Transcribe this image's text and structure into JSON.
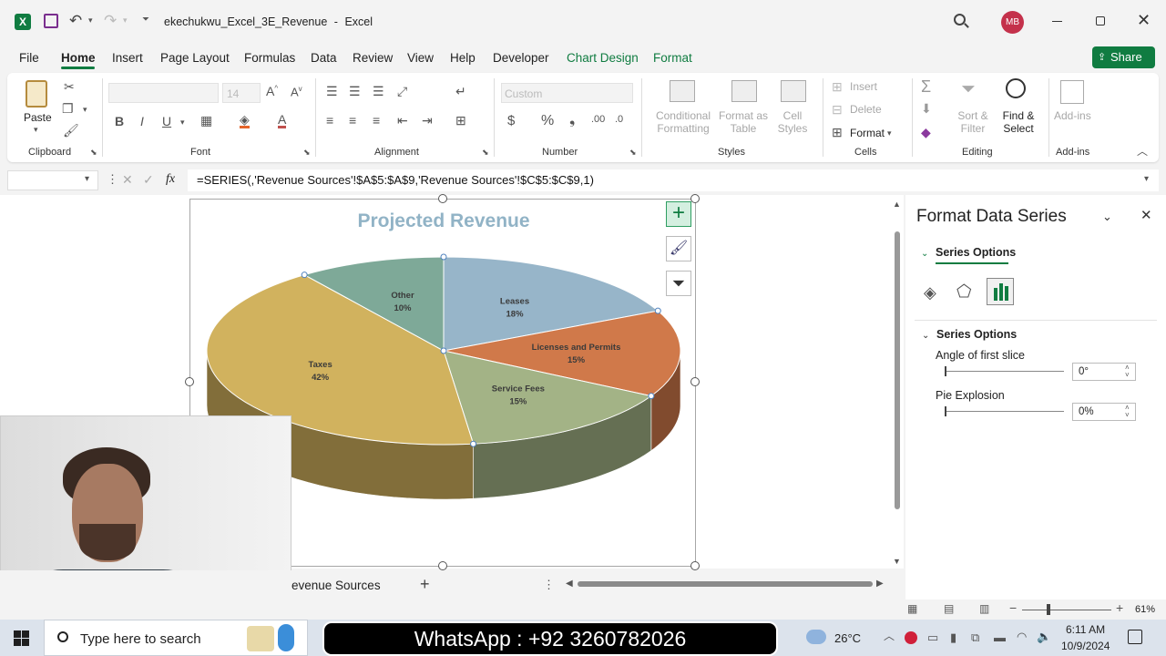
{
  "titlebar": {
    "filename": "ekechukwu_Excel_3E_Revenue",
    "dash": "-",
    "app": "Excel",
    "user_initials": "MB"
  },
  "menu": {
    "tabs": [
      "File",
      "Home",
      "Insert",
      "Page Layout",
      "Formulas",
      "Data",
      "Review",
      "View",
      "Help",
      "Developer",
      "Chart Design",
      "Format"
    ],
    "active": "Home",
    "share": "Share"
  },
  "ribbon": {
    "clipboard": {
      "paste": "Paste",
      "label": "Clipboard"
    },
    "font": {
      "size": "14",
      "label": "Font"
    },
    "alignment": {
      "label": "Alignment"
    },
    "number": {
      "format": "Custom",
      "label": "Number"
    },
    "styles": {
      "conditional_1": "Conditional",
      "conditional_2": "Formatting",
      "format_as_1": "Format as",
      "format_as_2": "Table",
      "cell_1": "Cell",
      "cell_2": "Styles",
      "label": "Styles"
    },
    "cells": {
      "insert": "Insert",
      "delete": "Delete",
      "format": "Format",
      "label": "Cells"
    },
    "editing": {
      "sort_1": "Sort &",
      "sort_2": "Filter",
      "find_1": "Find &",
      "find_2": "Select",
      "label": "Editing"
    },
    "addins": {
      "name": "Add-ins",
      "label": "Add-ins"
    }
  },
  "formula_bar": {
    "fx": "fx",
    "formula": "=SERIES(,'Revenue Sources'!$A$5:$A$9,'Revenue Sources'!$C$5:$C$9,1)"
  },
  "chart_data": {
    "type": "pie",
    "title": "Projected Revenue",
    "categories": [
      "Leases",
      "Licenses and Permits",
      "Service Fees",
      "Taxes",
      "Other"
    ],
    "values": [
      18,
      15,
      15,
      42,
      10
    ],
    "value_labels": [
      "18%",
      "15%",
      "15%",
      "42%",
      "10%"
    ],
    "colors": [
      "#97b5c9",
      "#d0794a",
      "#a3b386",
      "#d1b25e",
      "#7ea998"
    ],
    "first_slice_angle": 0,
    "explosion": 0
  },
  "panel": {
    "title": "Format Data Series",
    "series_options_dropdown": "Series Options",
    "section": "Series Options",
    "angle_label": "Angle of first slice",
    "angle_value": "0°",
    "explosion_label": "Pie Explosion",
    "explosion_value": "0%"
  },
  "sheet": {
    "tab": "evenue Sources",
    "add": "+"
  },
  "status": {
    "zoom": "61%"
  },
  "taskbar": {
    "search": "Type here to search",
    "banner": "WhatsApp : +92 3260782026",
    "temp": "26°C",
    "time": "6:11 AM",
    "date": "10/9/2024"
  }
}
